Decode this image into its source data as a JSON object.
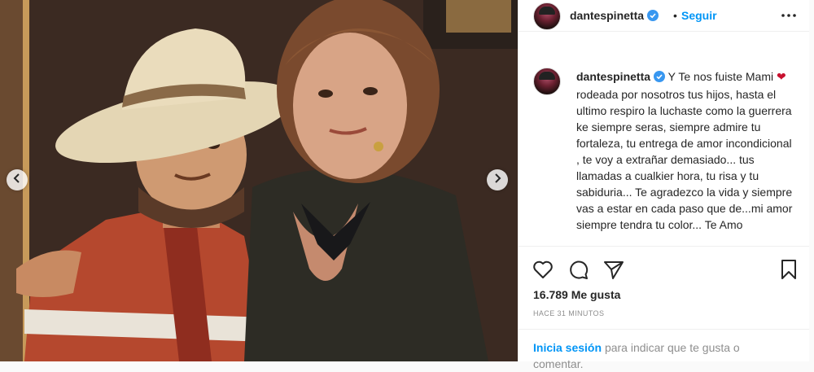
{
  "post": {
    "username": "dantespinetta",
    "follow_label": "Seguir",
    "separator": "•",
    "caption_parts": [
      "Y Te nos fuiste Mami",
      "❤",
      "rodeada por nosotros tus hijos, hasta el ultimo respiro la luchaste como la guerrera ke siempre seras, siempre admire tu fortaleza, tu entrega de amor incondicional , te voy a extrañar demasiado... tus llamadas a cualkier hora, tu risa y tu sabiduria... Te agradezco la vida y siempre vas a estar en cada paso que de...mi amor siempre tendra tu color... Te Amo"
    ],
    "likes": "16.789 Me gusta",
    "time_ago": "HACE 31 MINUTOS",
    "login_link": "Inicia sesión",
    "login_rest": "para indicar que te gusta o comentar."
  },
  "icons": {
    "verified": "verified-badge-icon",
    "more": "more-options-icon",
    "like": "heart-outline-icon",
    "comment": "comment-bubble-icon",
    "share": "paper-plane-icon",
    "save": "bookmark-icon",
    "prev": "chevron-left-icon",
    "next": "chevron-right-icon"
  },
  "colors": {
    "accent": "#0095f6",
    "verified": "#3897f0",
    "heart": "#c8102e"
  }
}
